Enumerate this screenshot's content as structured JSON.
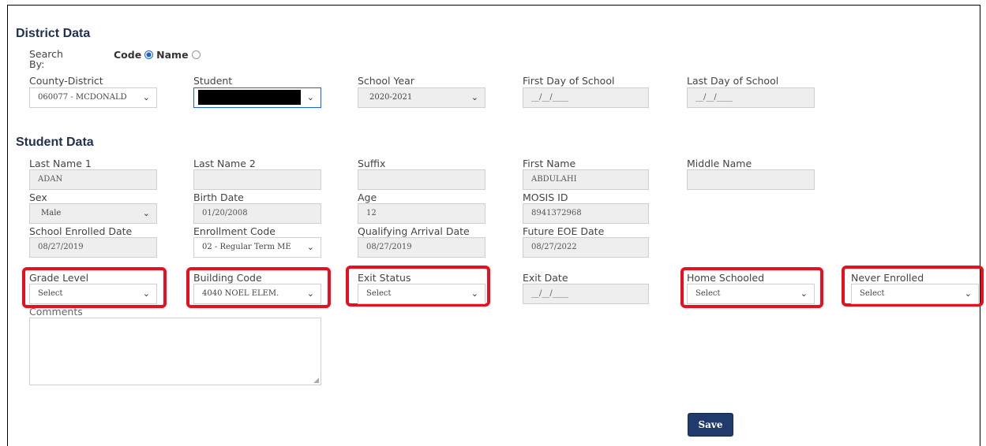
{
  "district": {
    "title": "District Data",
    "search_by_label": "Search By:",
    "code_label": "Code",
    "name_label": "Name",
    "county_district_label": "County-District",
    "county_district_value": "060077 - MCDONALD",
    "student_label": "Student",
    "school_year_label": "School Year",
    "school_year_value": "2020-2021",
    "first_day_label": "First Day of School",
    "first_day_value": "__/__/____",
    "last_day_label": "Last Day of School",
    "last_day_value": "__/__/____"
  },
  "student": {
    "title": "Student Data",
    "last_name1_label": "Last Name 1",
    "last_name1_value": "ADAN",
    "last_name2_label": "Last Name 2",
    "last_name2_value": "",
    "suffix_label": "Suffix",
    "suffix_value": "",
    "first_name_label": "First Name",
    "first_name_value": "ABDULAHI",
    "middle_name_label": "Middle Name",
    "middle_name_value": "",
    "sex_label": "Sex",
    "sex_value": "Male",
    "birth_date_label": "Birth Date",
    "birth_date_value": "01/20/2008",
    "age_label": "Age",
    "age_value": "12",
    "mosis_label": "MOSIS ID",
    "mosis_value": "8941372968",
    "enrolled_date_label": "School Enrolled Date",
    "enrolled_date_value": "08/27/2019",
    "enrollment_code_label": "Enrollment Code",
    "enrollment_code_value": "02 - Regular Term ME",
    "qualifying_label": "Qualifying Arrival Date",
    "qualifying_value": "08/27/2019",
    "future_eoe_label": "Future EOE Date",
    "future_eoe_value": "08/27/2022",
    "grade_level_label": "Grade Level",
    "grade_level_value": "Select",
    "building_code_label": "Building Code",
    "building_code_value": "4040 NOEL ELEM.",
    "exit_status_label": "Exit Status",
    "exit_status_value": "Select",
    "exit_date_label": "Exit Date",
    "exit_date_value": "__/__/____",
    "home_schooled_label": "Home Schooled",
    "home_schooled_value": "Select",
    "never_enrolled_label": "Never Enrolled",
    "never_enrolled_value": "Select",
    "comments_label": "Comments"
  },
  "actions": {
    "save_label": "Save"
  },
  "colors": {
    "highlight": "#e8101e",
    "save_button": "#1f3a6b"
  }
}
